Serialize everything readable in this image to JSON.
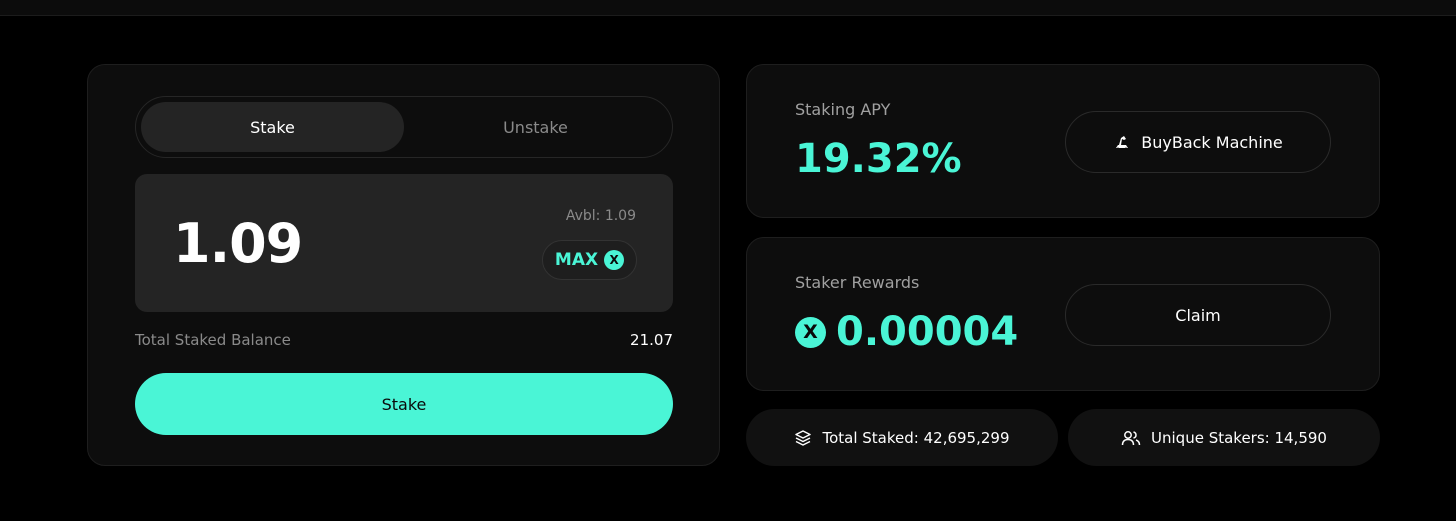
{
  "toggle": {
    "stake_label": "Stake",
    "unstake_label": "Unstake"
  },
  "input": {
    "amount": "1.09",
    "available": "Avbl: 1.09",
    "max_label": "MAX",
    "token_glyph": "X"
  },
  "balance": {
    "label": "Total Staked Balance",
    "value": "21.07"
  },
  "submit": {
    "label": "Stake"
  },
  "apy": {
    "label": "Staking APY",
    "value": "19.32%",
    "button_label": "BuyBack Machine"
  },
  "rewards": {
    "label": "Staker Rewards",
    "value": "0.00004",
    "button_label": "Claim",
    "token_glyph": "X"
  },
  "stats": {
    "total_staked": "Total Staked: 42,695,299",
    "unique_stakers": "Unique Stakers: 14,590"
  },
  "colors": {
    "accent": "#4af5d6",
    "background": "#000000",
    "card": "#0d0d0d",
    "input": "#242424"
  },
  "icons": {
    "buyback": "excavator-icon",
    "total": "layers-icon",
    "unique": "users-icon",
    "token": "x-token-icon"
  }
}
